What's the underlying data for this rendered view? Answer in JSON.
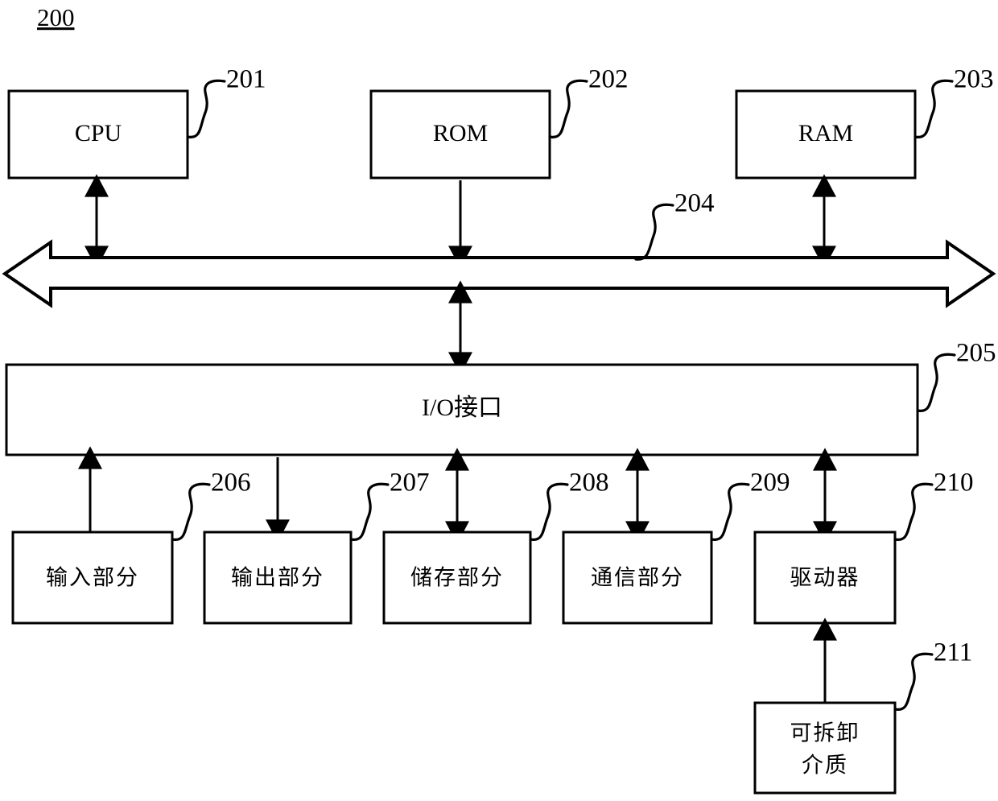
{
  "figure": {
    "number": "200",
    "type": "computer-system-block-diagram"
  },
  "blocks": {
    "cpu": {
      "label": "CPU",
      "ref": "201"
    },
    "rom": {
      "label": "ROM",
      "ref": "202"
    },
    "ram": {
      "label": "RAM",
      "ref": "203"
    },
    "bus": {
      "label": "",
      "ref": "204"
    },
    "io_interface": {
      "label": "I/O接口",
      "ref": "205"
    },
    "input_part": {
      "label": "输入部分",
      "ref": "206"
    },
    "output_part": {
      "label": "输出部分",
      "ref": "207"
    },
    "storage_part": {
      "label": "储存部分",
      "ref": "208"
    },
    "communication_part": {
      "label": "通信部分",
      "ref": "209"
    },
    "driver": {
      "label": "驱动器",
      "ref": "210"
    },
    "removable_media": {
      "label_line1": "可拆卸",
      "label_line2": "介质",
      "ref": "211"
    }
  },
  "connections": {
    "cpu_to_bus": "bidirectional",
    "rom_to_bus": "down",
    "ram_to_bus": "bidirectional",
    "bus_to_io": "bidirectional",
    "io_to_input": "up",
    "io_to_output": "down",
    "io_to_storage": "bidirectional",
    "io_to_communication": "bidirectional",
    "io_to_driver": "bidirectional",
    "removable_to_driver": "up"
  },
  "colors": {
    "stroke": "#000000",
    "fill": "#ffffff"
  }
}
